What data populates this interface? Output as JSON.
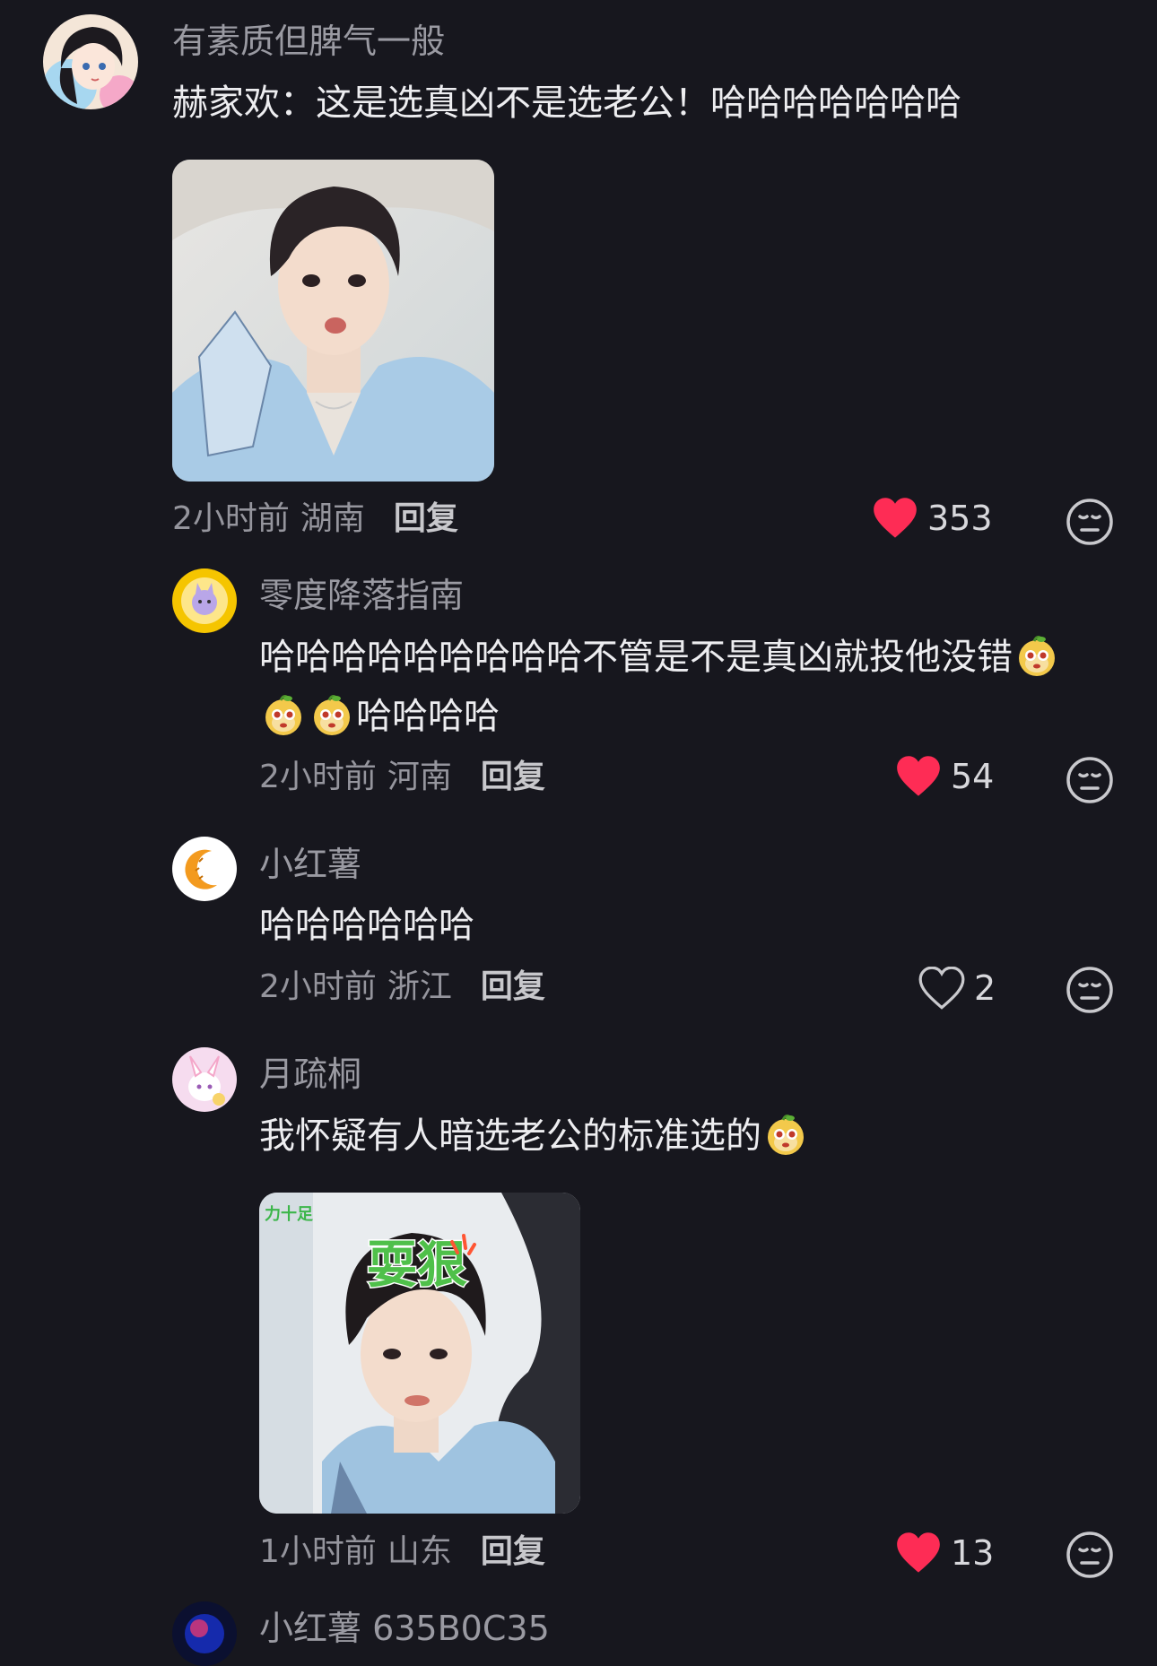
{
  "colors": {
    "background": "#17171e",
    "like_red": "#fe2c55",
    "muted": "#95959d"
  },
  "comments": [
    {
      "username": "有素质但脾气一般",
      "text": "赫家欢：这是选真凶不是选老公！哈哈哈哈哈哈哈",
      "has_image": true,
      "time": "2小时前",
      "location": "湖南",
      "reply_label": "回复",
      "likes": "353",
      "liked": true
    },
    {
      "username": "零度降落指南",
      "text_line1": "哈哈哈哈哈哈哈哈哈不管是不是真凶就投他没错",
      "text_line2": "哈哈哈哈",
      "inline_emoji": "monkey-face-emoji",
      "time": "2小时前",
      "location": "河南",
      "reply_label": "回复",
      "likes": "54",
      "liked": true
    },
    {
      "username": "小红薯",
      "text": "哈哈哈哈哈哈",
      "time": "2小时前",
      "location": "浙江",
      "reply_label": "回复",
      "likes": "2",
      "liked": false
    },
    {
      "username": "月疏桐",
      "text": "我怀疑有人暗选老公的标准选的",
      "has_image": true,
      "sticker_text": "耍狠",
      "corner_text": "力十足",
      "time": "1小时前",
      "location": "山东",
      "reply_label": "回复",
      "likes": "13",
      "liked": true
    },
    {
      "username": "小红薯 635B0C35"
    }
  ],
  "icons": {
    "like": "heart-icon",
    "emoji_react": "neutral-face-icon"
  }
}
